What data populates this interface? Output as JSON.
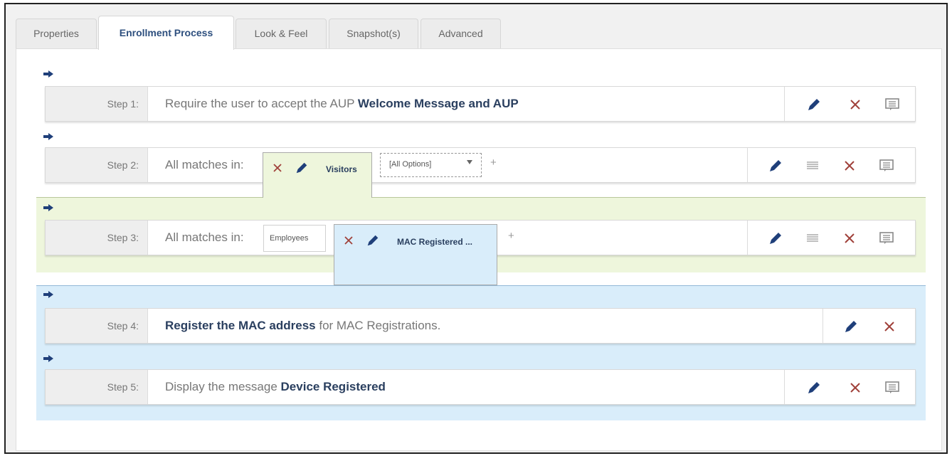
{
  "tabs": [
    {
      "label": "Properties"
    },
    {
      "label": "Enrollment Process"
    },
    {
      "label": "Look & Feel"
    },
    {
      "label": "Snapshot(s)"
    },
    {
      "label": "Advanced"
    }
  ],
  "steps": [
    {
      "label": "Step 1:",
      "text_pre": "Require the user to accept the AUP ",
      "text_bold": "Welcome Message and AUP"
    },
    {
      "label": "Step 2:",
      "text_pre": "All matches in:",
      "chip_main": "Visitors",
      "select_value": "[All Options]"
    },
    {
      "label": "Step 3:",
      "text_pre": "All matches in:",
      "chip_first": "Employees",
      "chip_main": "MAC Registered ..."
    },
    {
      "label": "Step 4:",
      "text_bold": "Register the MAC address",
      "text_post": " for MAC Registrations."
    },
    {
      "label": "Step 5:",
      "text_pre": "Display the message ",
      "text_bold": "Device Registered"
    }
  ],
  "icons": {
    "arrow": "right-arrow-icon",
    "edit": "pencil-icon",
    "delete": "x-icon",
    "message": "message-icon",
    "reorder": "list-icon",
    "dropdown": "caret-down-icon",
    "add": "+"
  },
  "colors": {
    "accent": "#2a3f5f",
    "delete": "#a0413a",
    "green_band": "#eef6dc",
    "blue_band": "#d9edfa"
  }
}
